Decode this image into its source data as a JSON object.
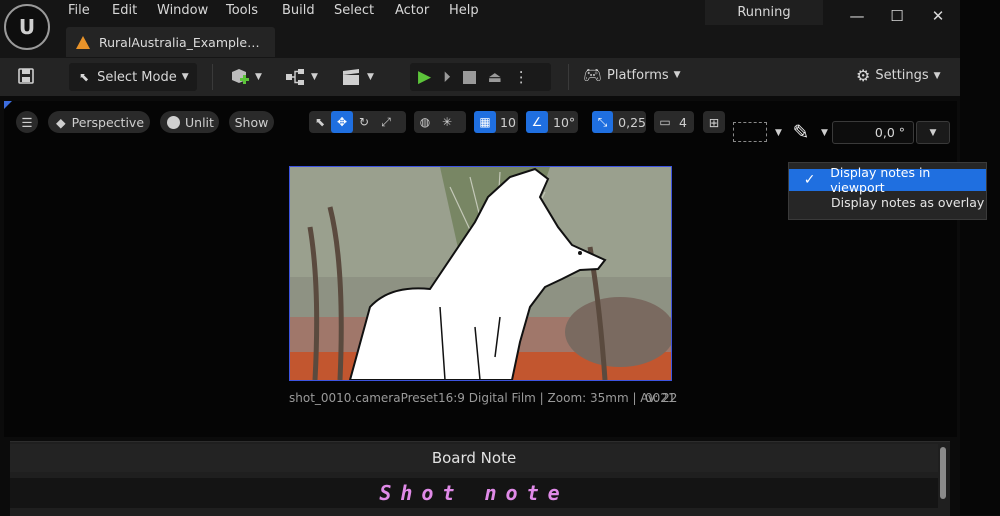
{
  "app": {
    "logo": "U",
    "status": "Running"
  },
  "menu": [
    "File",
    "Edit",
    "Window",
    "Tools",
    "Build",
    "Select",
    "Actor",
    "Help"
  ],
  "window_controls": {
    "minimize": "—",
    "maximize": "☐",
    "close": "✕"
  },
  "tab": {
    "title": "RuralAustralia_Example…"
  },
  "toolbar": {
    "select_mode": "Select Mode",
    "platforms": "Platforms",
    "settings": "Settings"
  },
  "viewport": {
    "perspective": "Perspective",
    "unlit": "Unlit",
    "show": "Show",
    "grid_snap": "10",
    "rot_snap": "10°",
    "scale_snap": "0,25",
    "camera_speed": "4",
    "angle_value": "0,0 °"
  },
  "dropdown": {
    "items": [
      {
        "label": "Display notes in viewport",
        "selected": true
      },
      {
        "label": "Display notes as overlay",
        "selected": false
      }
    ]
  },
  "frame": {
    "caption": "shot_0010.cameraPreset16:9 Digital Film | Zoom: 35mm | Av: 22",
    "frame_number": "0021"
  },
  "board_note": {
    "header": "Board Note",
    "text": "Shot note"
  },
  "colors": {
    "accent": "#1f6fe0",
    "note_text": "#e08ae8",
    "frame_border": "#3d54e0"
  }
}
